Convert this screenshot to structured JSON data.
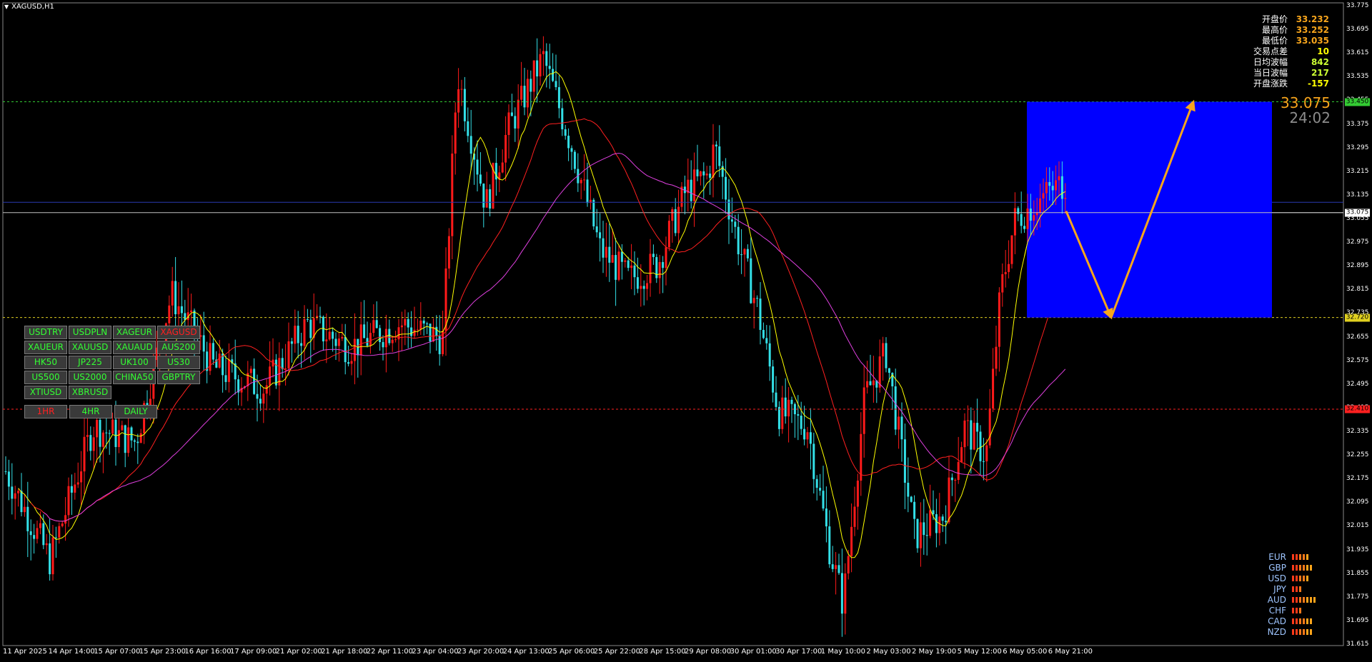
{
  "title": "XAGUSD,H1",
  "stats": [
    {
      "label": "开盘价",
      "value": "33.232",
      "color": "#f7a51c"
    },
    {
      "label": "最高价",
      "value": "33.252",
      "color": "#f7a51c"
    },
    {
      "label": "最低价",
      "value": "33.035",
      "color": "#f7a51c"
    },
    {
      "label": "交易点差",
      "value": "10",
      "color": "#ffff00"
    },
    {
      "label": "日均波幅",
      "value": "842",
      "color": "#ccff33"
    },
    {
      "label": "当日波幅",
      "value": "217",
      "color": "#ccff33"
    },
    {
      "label": "开盘涨跌",
      "value": "-157",
      "color": "#ffff00"
    }
  ],
  "current_price": "33.075",
  "bar_timer": "24:02",
  "symbols": [
    "USDTRY",
    "USDPLN",
    "XAGEUR",
    "XAGUSD",
    "XAUEUR",
    "XAUUSD",
    "XAUAUD",
    "AUS200",
    "HK50",
    "JP225",
    "UK100",
    "US30",
    "US500",
    "US2000",
    "CHINA50",
    "GBPTRY",
    "XTIUSD",
    "XBRUSD"
  ],
  "active_symbol": "XAGUSD",
  "timeframes": [
    "1HR",
    "4HR",
    "DAILY"
  ],
  "active_timeframe": "1HR",
  "currency_strength": [
    {
      "name": "EUR",
      "level": 5
    },
    {
      "name": "GBP",
      "level": 6
    },
    {
      "name": "USD",
      "level": 5
    },
    {
      "name": "JPY",
      "level": 3
    },
    {
      "name": "AUD",
      "level": 7
    },
    {
      "name": "CHF",
      "level": 3
    },
    {
      "name": "CAD",
      "level": 6
    },
    {
      "name": "NZD",
      "level": 6
    }
  ],
  "price_axis": [
    "33.775",
    "33.695",
    "33.615",
    "33.535",
    "33.455",
    "33.375",
    "33.295",
    "33.215",
    "33.135",
    "33.055",
    "32.975",
    "32.895",
    "32.815",
    "32.735",
    "32.655",
    "32.575",
    "32.495",
    "32.415",
    "32.335",
    "32.255",
    "32.175",
    "32.095",
    "32.015",
    "31.935",
    "31.855",
    "31.775",
    "31.695",
    "31.615"
  ],
  "price_badges": {
    "upper": "33.450",
    "current": "33.075",
    "lower_yellow": "32.720",
    "lower_red": "32.410"
  },
  "time_axis": [
    "11 Apr 2025",
    "14 Apr 14:00",
    "15 Apr 07:00",
    "15 Apr 23:00",
    "16 Apr 16:00",
    "17 Apr 09:00",
    "21 Apr 02:00",
    "21 Apr 18:00",
    "22 Apr 11:00",
    "23 Apr 04:00",
    "23 Apr 20:00",
    "24 Apr 13:00",
    "25 Apr 06:00",
    "25 Apr 22:00",
    "28 Apr 15:00",
    "29 Apr 08:00",
    "30 Apr 01:00",
    "30 Apr 17:00",
    "1 May 10:00",
    "2 May 03:00",
    "2 May 19:00",
    "5 May 12:00",
    "6 May 05:00",
    "6 May 21:00"
  ],
  "colors": {
    "bull": "#ff1a1a",
    "bear": "#33e0e8",
    "ma_fast": "#ffff00",
    "ma_mid": "#ff2020",
    "ma_slow": "#e040e0",
    "target_box": "#0000ff",
    "arrow": "#f7a51c"
  }
}
